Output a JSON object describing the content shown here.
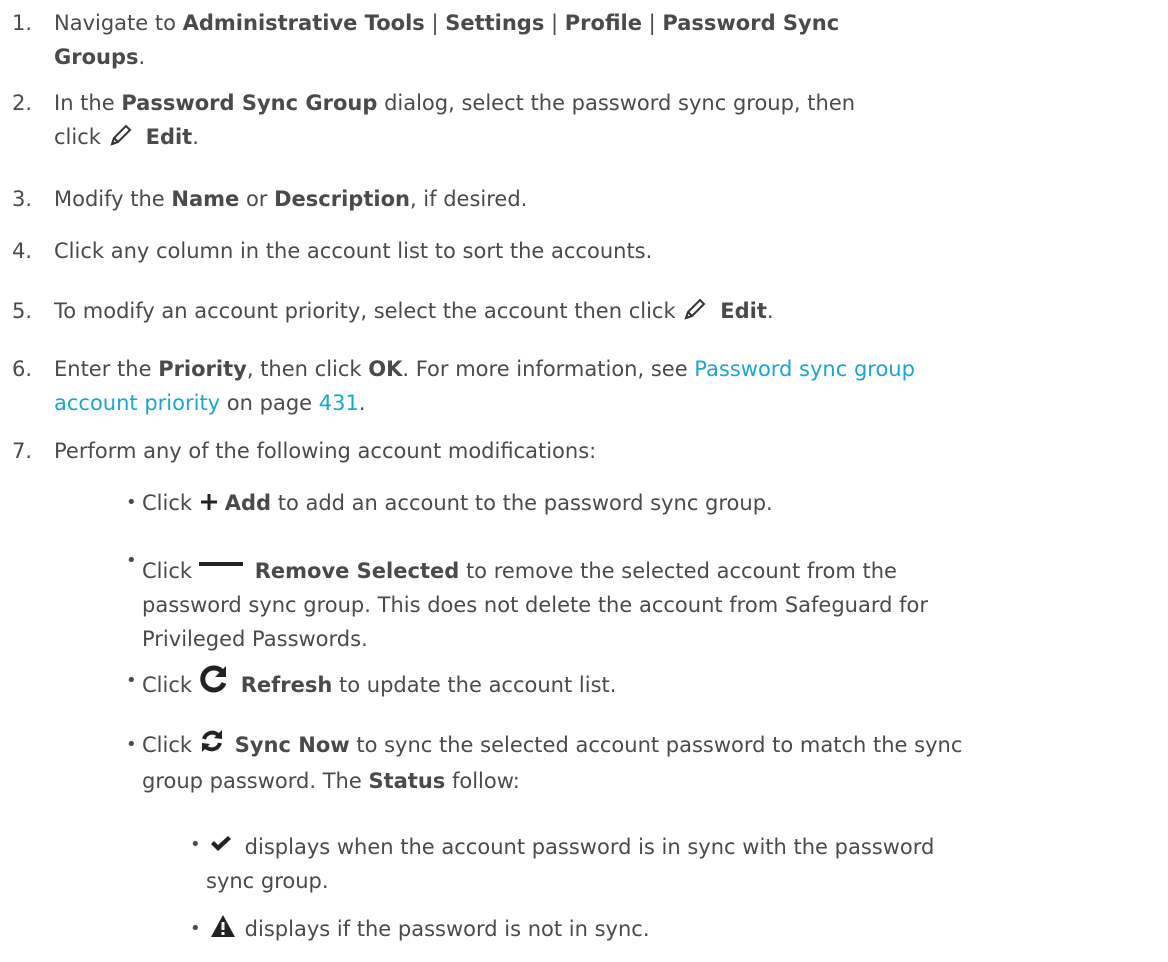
{
  "steps": [
    {
      "num": "1.",
      "pre": "Navigate to ",
      "b1": "Administrative Tools",
      "sep1": " | ",
      "b2": "Settings",
      "sep2": " | ",
      "b3": "Profile",
      "sep3": " | ",
      "b4": "Password Sync",
      "b5": "Groups",
      "post": "."
    },
    {
      "num": "2.",
      "pre": "In the ",
      "b1": "Password Sync Group",
      "mid": " dialog, select the password sync group, then",
      "click": "click ",
      "b2": "Edit",
      "post": "."
    },
    {
      "num": "3.",
      "pre": "Modify the ",
      "b1": "Name",
      "mid": " or ",
      "b2": "Description",
      "post": ", if desired."
    },
    {
      "num": "4.",
      "text": "Click any column in the account list to sort the accounts."
    },
    {
      "num": "5.",
      "pre": "To modify an account priority, select the account then click ",
      "b1": "Edit",
      "post": "."
    },
    {
      "num": "6.",
      "pre": "Enter the ",
      "b1": "Priority",
      "mid": ", then click ",
      "b2": "OK",
      "mid2": ". For more information, see ",
      "link1": "Password sync group",
      "link2": "account priority",
      "mid3": " on page ",
      "page": "431",
      "post": "."
    },
    {
      "num": "7.",
      "text": "Perform any of the following account modifications:"
    }
  ],
  "bullets": [
    {
      "dot": "•",
      "pre": "Click ",
      "bold": "Add",
      "post": " to add an account to the password sync group.",
      "icon": "plus-icon"
    },
    {
      "dot": "•",
      "pre": "Click ",
      "bold": "Remove Selected",
      "post": " to remove the selected account from the",
      "line2": "password sync group. This does not delete the account from Safeguard for",
      "line3": "Privileged Passwords.",
      "icon": "minus-icon"
    },
    {
      "dot": "•",
      "pre": "Click ",
      "bold": "Refresh",
      "post": " to update the account list.",
      "icon": "refresh-icon"
    },
    {
      "dot": "•",
      "pre": "Click ",
      "bold": "Sync Now",
      "post": " to sync the selected account password to match the sync",
      "line2pre": "group password. The ",
      "line2bold": "Status",
      "line2post": " follow:",
      "icon": "sync-icon"
    }
  ],
  "sub_bullets": [
    {
      "dot": "•",
      "text": " displays when the account password is in sync with the password",
      "line2": "sync group.",
      "icon": "checkmark-icon"
    },
    {
      "dot": "•",
      "text": " displays if the password is not in sync.",
      "icon": "warning-icon"
    }
  ]
}
